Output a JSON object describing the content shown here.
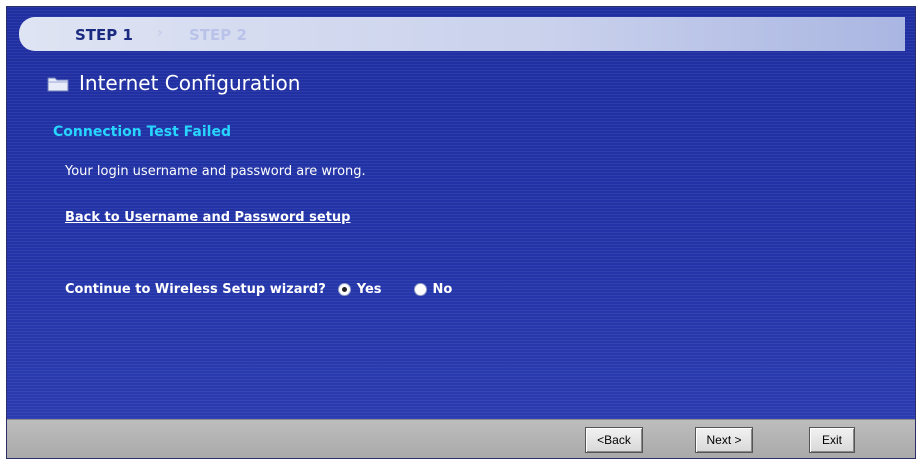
{
  "steps": {
    "step1_label": "STEP 1",
    "separator": "›",
    "step2_label": "STEP 2"
  },
  "header": {
    "icon": "folder-icon",
    "title": "Internet Configuration"
  },
  "status": {
    "heading": "Connection Test Failed",
    "message": "Your login username and password are wrong."
  },
  "links": {
    "back_to_setup": "Back to Username and Password setup"
  },
  "wizard": {
    "question": "Continue to Wireless Setup wizard?",
    "options": [
      {
        "label": "Yes",
        "selected": true
      },
      {
        "label": "No",
        "selected": false
      }
    ]
  },
  "buttons": {
    "back": "<Back",
    "next": "Next >",
    "exit": "Exit"
  },
  "colors": {
    "background": "#2333a0",
    "heading_accent": "#27d6ff",
    "step_active": "#1a2a80"
  }
}
